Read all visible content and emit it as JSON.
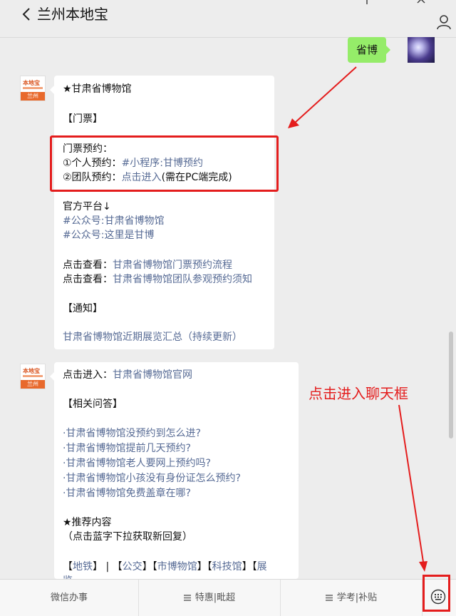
{
  "header": {
    "title": "兰州本地宝"
  },
  "outgoing": {
    "text": "省博"
  },
  "avatar": {
    "logo_text": "本地宝",
    "city": "兰州"
  },
  "message1": {
    "museum_title": "★甘肃省博物馆",
    "ticket_heading": "【门票】",
    "booking_label": "门票预约：",
    "personal_label": "①个人预约：",
    "personal_link": "#小程序:甘博预约",
    "group_label": "②团队预约：",
    "group_link": "点击进入",
    "group_note": "(需在PC端完成)",
    "official_label": "官方平台↓",
    "official_links": [
      "#公众号:甘肃省博物馆",
      "#公众号:这里是甘博"
    ],
    "view_label": "点击查看：",
    "view_links": [
      "甘肃省博物馆门票预约流程",
      "甘肃省博物馆团队参观预约须知"
    ],
    "notice_heading": "【通知】",
    "notice_link": "甘肃省博物馆近期展览汇总（持续更新）"
  },
  "message2": {
    "enter_label": "点击进入：",
    "enter_link": "甘肃省博物馆官网",
    "qa_heading": "【相关问答】",
    "qa_links": [
      "·甘肃省博物馆没预约到怎么进?",
      "·甘肃省博物馆提前几天预约?",
      "·甘肃省博物馆老人要网上预约吗?",
      "·甘肃省博物馆小孩没有身份证怎么预约?",
      "·甘肃省博物馆免费盖章在哪?"
    ],
    "recommend_heading": "★推荐内容",
    "recommend_note": "（点击蓝字下拉获取新回复）",
    "tags_open": "【",
    "tags_close": "】",
    "tags_sep": "|",
    "tags": [
      "地铁",
      "公交",
      "市博物馆",
      "科技馆",
      "展"
    ],
    "tags_overflow": "览"
  },
  "annotation": {
    "text": "点击进入聊天框",
    "color": "#e41d1d"
  },
  "bottom_menu": {
    "items": [
      "微信办事",
      "特惠|毗超",
      "学考|补贴"
    ]
  },
  "colors": {
    "link": "#576b95",
    "outgoing_bubble": "#95ec69",
    "background": "#ededed"
  }
}
